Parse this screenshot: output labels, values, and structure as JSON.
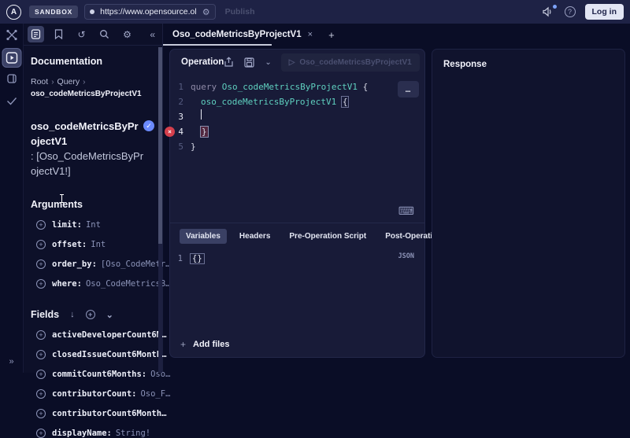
{
  "colors": {
    "accent_teal": "#5fd0bf",
    "error_red": "#d5404d",
    "check_blue": "#6b8afd",
    "notification_blue": "#7da2f7"
  },
  "icons": {
    "plus": "+",
    "close": "×",
    "add_tab": "+",
    "collapse_left": "«",
    "expand_right": "»",
    "chevron_down": "⌄",
    "double_chevron": "»",
    "sort_down": "↓",
    "gear": "⚙",
    "history": "↺",
    "more": "…",
    "run_play": "▷",
    "breadcrumb_sep": "›",
    "check": "✓",
    "help": "?",
    "keyboard": "⌨"
  },
  "topbar": {
    "logo_letter": "A",
    "sandbox_label": "SANDBOX",
    "url": "https://www.opensource.ol",
    "publish_label": "Publish",
    "login_label": "Log in"
  },
  "tabbar": {
    "active_tab": "Oso_codeMetricsByProjectV1"
  },
  "docs": {
    "panel_title": "Documentation",
    "breadcrumb": {
      "root": "Root",
      "parent": "Query",
      "current": "oso_codeMetricsByProjectV1"
    },
    "selected_field": {
      "name": "oso_codeMetricsByProjectV1",
      "type": ": [Oso_CodeMetricsByProjectV1!]"
    },
    "arguments_title": "Arguments",
    "arguments": [
      {
        "name": "limit:",
        "type": "Int"
      },
      {
        "name": "offset:",
        "type": "Int"
      },
      {
        "name": "order_by:",
        "type": "[Oso_CodeMetr…"
      },
      {
        "name": "where:",
        "type": "Oso_CodeMetricsB…"
      }
    ],
    "fields_title": "Fields",
    "fields": [
      {
        "name": "activeDeveloperCount6M…",
        "type": ""
      },
      {
        "name": "closedIssueCount6Month…",
        "type": ""
      },
      {
        "name": "commitCount6Months:",
        "type": "Oso…"
      },
      {
        "name": "contributorCount:",
        "type": "Oso_F…"
      },
      {
        "name": "contributorCount6Month…",
        "type": ""
      },
      {
        "name": "displayName:",
        "type": "String!"
      }
    ]
  },
  "operation": {
    "title": "Operation",
    "run_label": "Oso_codeMetricsByProjectV1",
    "line_numbers": [
      "1",
      "2",
      "3",
      "4",
      "5"
    ],
    "code": {
      "l1_keyword": "query",
      "l1_name": "Oso_codeMetricsByProjectV1",
      "l1_brace": "{",
      "l2_name": "oso_codeMetricsByProjectV1",
      "l2_brace": "{",
      "l4_brace": "}",
      "l5_brace": "}"
    }
  },
  "variables_panel": {
    "tabs": [
      "Variables",
      "Headers",
      "Pre-Operation Script",
      "Post-Operation Script"
    ],
    "active_tab": "Variables",
    "line_number": "1",
    "content": "{}",
    "mode_label": "JSON",
    "add_files_label": "Add files"
  },
  "response": {
    "title": "Response"
  }
}
